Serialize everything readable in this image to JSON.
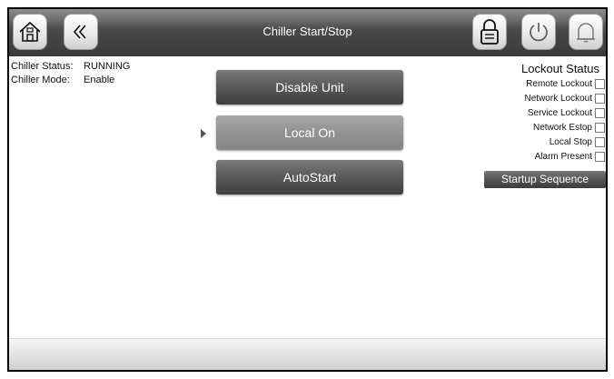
{
  "header": {
    "title": "Chiller Start/Stop",
    "home_icon": "home-icon",
    "back_icon": "double-chevron-left-icon",
    "lock_icon": "lock-icon",
    "power_icon": "power-icon",
    "bell_icon": "bell-icon"
  },
  "status": {
    "chiller_status_label": "Chiller Status:",
    "chiller_status_value": "RUNNING",
    "chiller_mode_label": "Chiller Mode:",
    "chiller_mode_value": "Enable"
  },
  "controls": {
    "disable_unit": "Disable Unit",
    "local_on": "Local On",
    "autostart": "AutoStart",
    "selected": "Local On"
  },
  "lockout": {
    "title": "Lockout Status",
    "items": [
      {
        "label": "Remote Lockout",
        "checked": false
      },
      {
        "label": "Network Lockout",
        "checked": false
      },
      {
        "label": "Service Lockout",
        "checked": false
      },
      {
        "label": "Network Estop",
        "checked": false
      },
      {
        "label": "Local Stop",
        "checked": false
      },
      {
        "label": "Alarm Present",
        "checked": false
      }
    ],
    "startup_button": "Startup Sequence"
  },
  "colors": {
    "header_bg": "#4a4a4a",
    "button_dark": "#5b5b5b",
    "button_selected": "#929292"
  }
}
